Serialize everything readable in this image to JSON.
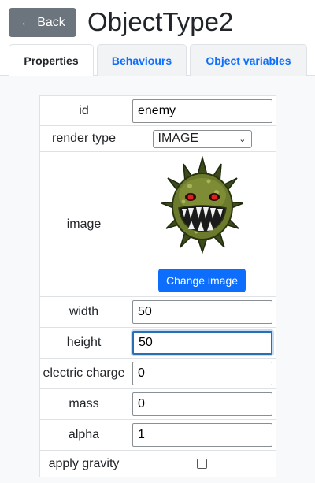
{
  "header": {
    "back_label": "Back",
    "title": "ObjectType2"
  },
  "tabs": [
    {
      "label": "Properties",
      "active": true
    },
    {
      "label": "Behaviours",
      "active": false
    },
    {
      "label": "Object variables",
      "active": false
    }
  ],
  "properties": {
    "id": {
      "label": "id",
      "value": "enemy"
    },
    "render_type": {
      "label": "render type",
      "value": "IMAGE"
    },
    "image": {
      "label": "image",
      "button_label": "Change image",
      "icon": "spiky-green-monster-sprite"
    },
    "width": {
      "label": "width",
      "value": "50"
    },
    "height": {
      "label": "height",
      "value": "50"
    },
    "electric_charge": {
      "label": "electric charge",
      "value": "0"
    },
    "mass": {
      "label": "mass",
      "value": "0"
    },
    "alpha": {
      "label": "alpha",
      "value": "1"
    },
    "apply_gravity": {
      "label": "apply gravity",
      "checked": false
    }
  },
  "colors": {
    "back_button": "#6c757d",
    "tab_link": "#0d6efd",
    "primary_button": "#0d6efd",
    "focus_border": "#2a6fb6"
  }
}
